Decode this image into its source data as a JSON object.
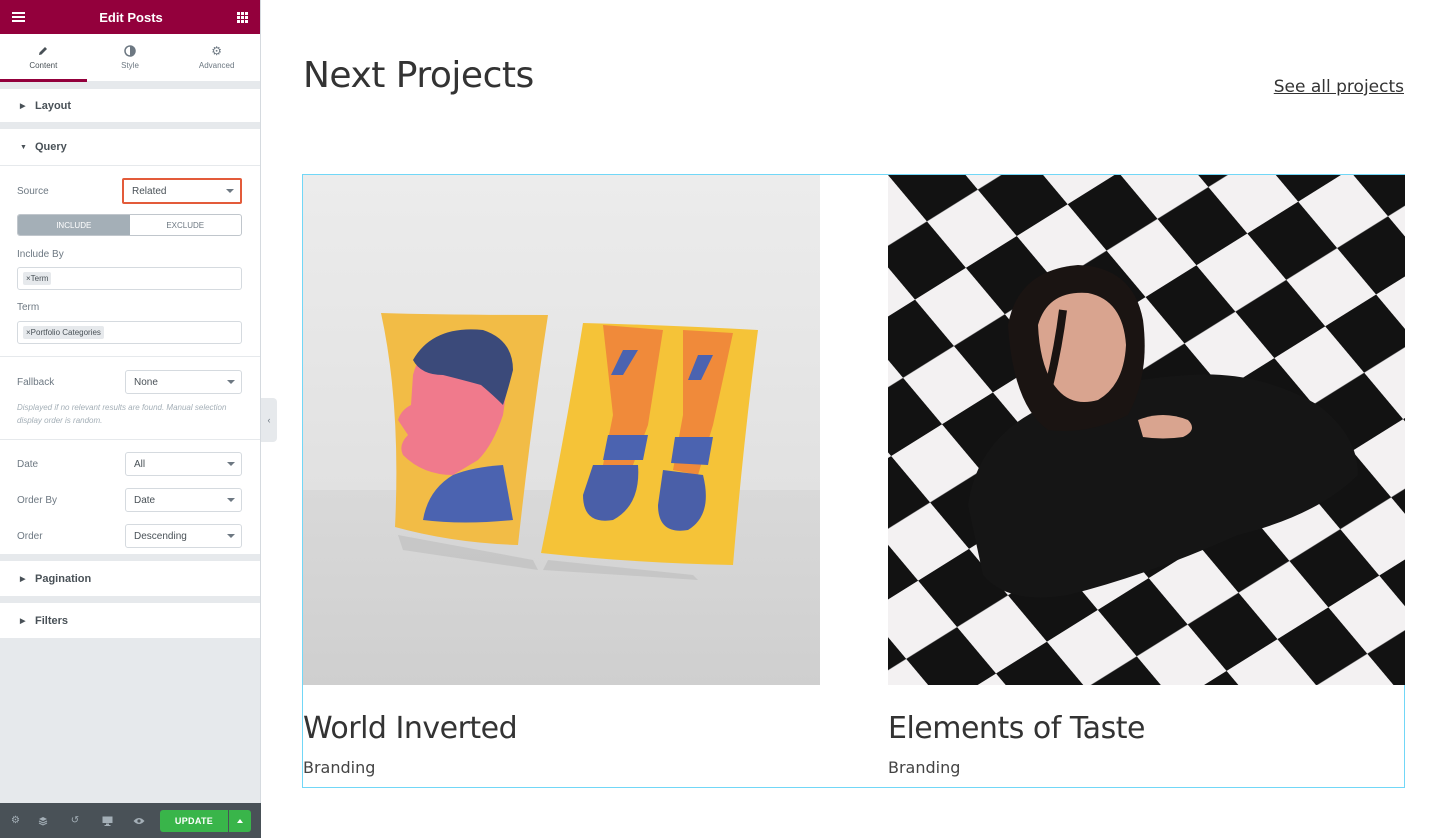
{
  "editor": {
    "title": "Edit Posts",
    "tabs": [
      {
        "label": "Content",
        "icon": "pencil-icon"
      },
      {
        "label": "Style",
        "icon": "half-circle-icon"
      },
      {
        "label": "Advanced",
        "icon": "gear-icon"
      }
    ],
    "sections": {
      "layout": "Layout",
      "query": "Query",
      "pagination": "Pagination",
      "filters": "Filters"
    },
    "query": {
      "source_label": "Source",
      "source_value": "Related",
      "include_label": "INCLUDE",
      "exclude_label": "EXCLUDE",
      "include_by_label": "Include By",
      "include_by_tag": "Term",
      "term_label": "Term",
      "term_tag": "Portfolio Categories",
      "fallback_label": "Fallback",
      "fallback_value": "None",
      "fallback_desc": "Displayed if no relevant results are found. Manual selection display order is random.",
      "date_label": "Date",
      "date_value": "All",
      "order_by_label": "Order By",
      "order_by_value": "Date",
      "order_label": "Order",
      "order_value": "Descending"
    },
    "footer": {
      "update_label": "UPDATE"
    },
    "colors": {
      "brand": "#93003c",
      "update": "#39b54a",
      "highlight": "#e35b3a"
    }
  },
  "preview": {
    "heading": "Next Projects",
    "see_all": "See all projects",
    "posts": [
      {
        "title": "World Inverted",
        "category": "Branding"
      },
      {
        "title": "Elements of Taste",
        "category": "Branding"
      }
    ]
  }
}
